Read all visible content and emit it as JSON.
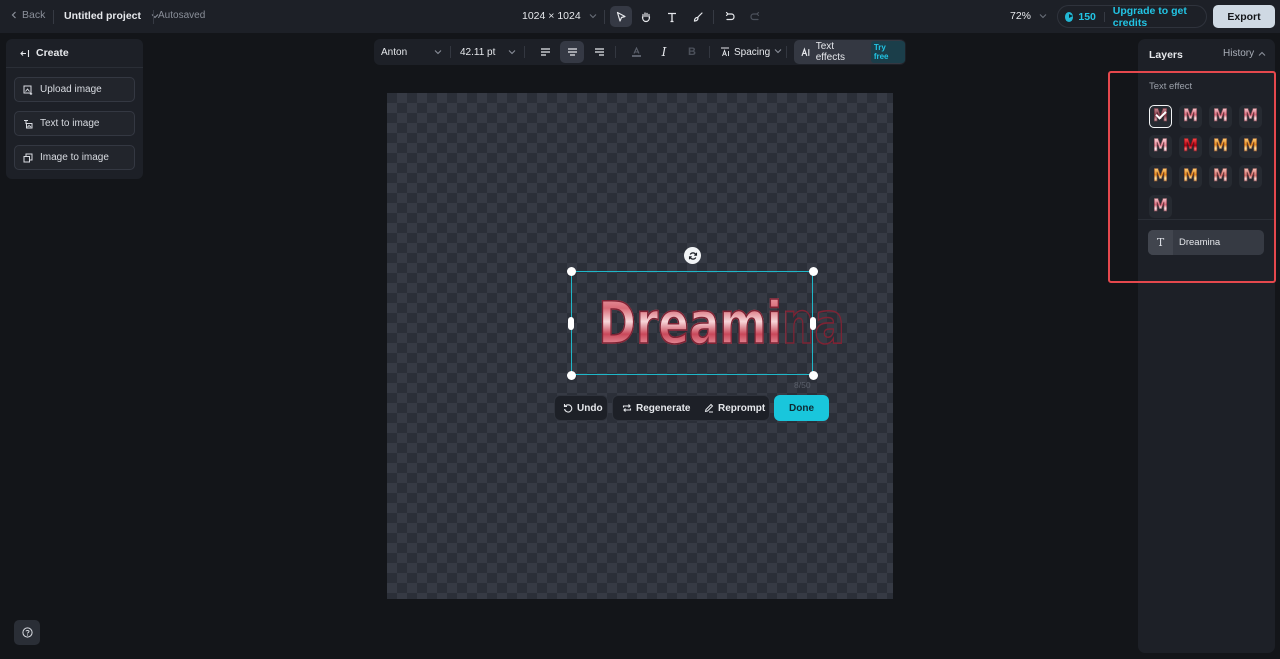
{
  "topbar": {
    "back_label": "Back",
    "project_title": "Untitled project",
    "save_status": "Autosaved",
    "canvas_size": "1024 × 1024",
    "tools": [
      {
        "name": "select-tool",
        "icon": "pointer-icon",
        "active": true
      },
      {
        "name": "hand-tool",
        "icon": "hand-icon",
        "active": false
      },
      {
        "name": "text-tool",
        "icon": "text-icon",
        "active": false
      },
      {
        "name": "brush-tool",
        "icon": "brush-icon",
        "active": false
      },
      {
        "name": "undo",
        "icon": "undo-icon",
        "active": false
      },
      {
        "name": "redo",
        "icon": "redo-icon",
        "active": false
      }
    ],
    "zoom_level": "72%",
    "credits": "150",
    "upgrade_label": "Upgrade to get credits",
    "export_label": "Export",
    "accent_color": "#22c4e4"
  },
  "create_panel": {
    "title": "Create",
    "items": [
      {
        "label": "Upload image",
        "icon": "upload-image-icon"
      },
      {
        "label": "Text to image",
        "icon": "text-to-image-icon"
      },
      {
        "label": "Image to image",
        "icon": "image-to-image-icon"
      }
    ]
  },
  "text_toolbar": {
    "font": "Anton",
    "font_size": "42.11 pt",
    "alignment": "center",
    "spacing_label": "Spacing",
    "text_effects_label": "Text effects",
    "try_free_label": "Try free",
    "bold_label": "B",
    "italic_label": "I"
  },
  "canvas": {
    "text": "Dreamina",
    "char_count": "8/50",
    "actions": {
      "undo_label": "Undo",
      "regenerate_label": "Regenerate",
      "reprompt_label": "Reprompt",
      "done_label": "Done"
    },
    "done_color": "#19c6dc",
    "selection_color": "#1fb7c8"
  },
  "right_panel": {
    "layers_label": "Layers",
    "history_label": "History",
    "text_effect_label": "Text effect",
    "effects": [
      {
        "style": "rose-chrome",
        "selected": true
      },
      {
        "style": "pink-chrome",
        "selected": false
      },
      {
        "style": "pink-chrome",
        "selected": false
      },
      {
        "style": "pink-chrome",
        "selected": false
      },
      {
        "style": "pink-glossy",
        "selected": false
      },
      {
        "style": "red-candy",
        "selected": false
      },
      {
        "style": "gold-glitter",
        "selected": false
      },
      {
        "style": "gold-glitter",
        "selected": false
      },
      {
        "style": "gold-glitter",
        "selected": false
      },
      {
        "style": "gold-glitter",
        "selected": false
      },
      {
        "style": "salmon-chrome",
        "selected": false
      },
      {
        "style": "salmon-chrome",
        "selected": false
      },
      {
        "style": "pink-chrome",
        "selected": false
      }
    ],
    "effect_glyph": "M",
    "layers": [
      {
        "name": "Dreamina",
        "type_icon": "T"
      }
    ],
    "highlight_color": "#e5484d"
  }
}
